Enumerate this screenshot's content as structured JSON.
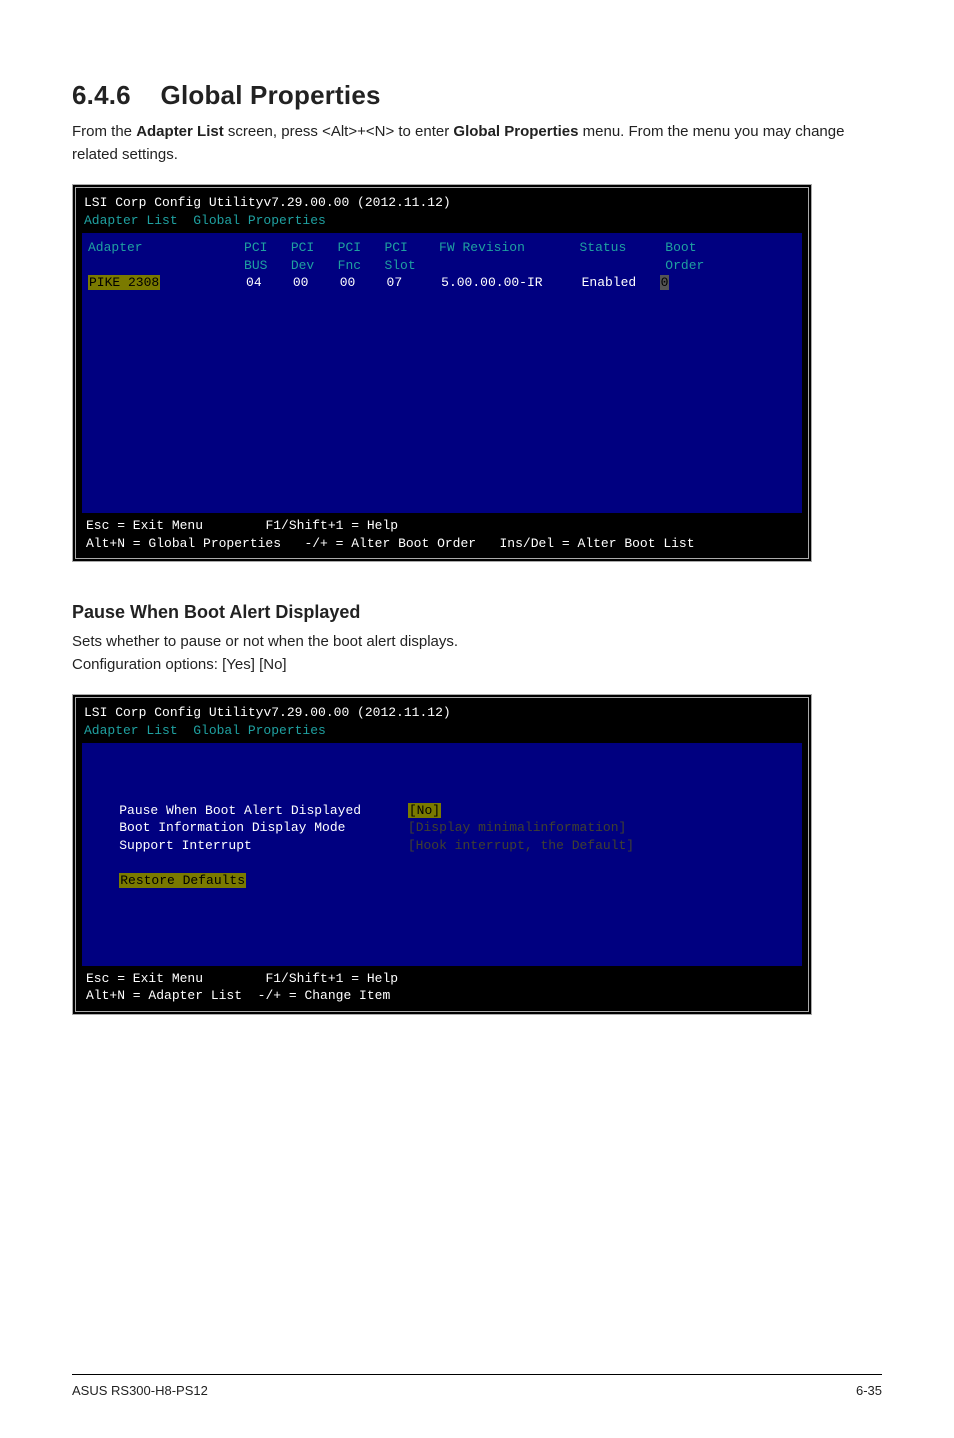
{
  "section": {
    "number": "6.4.6",
    "title": "Global Properties",
    "intro_pre": "From the ",
    "intro_b1": "Adapter List",
    "intro_mid": " screen, press <Alt>+<N> to enter ",
    "intro_b2": "Global Properties",
    "intro_post": " menu. From the menu you may change related settings."
  },
  "bios1": {
    "titlebar_left": "LSI Corp Config Utility",
    "titlebar_ver": "v7.29.00.00 (2012.11.12)",
    "tabs": "Adapter List  Global Properties",
    "headers": {
      "adapter": "Adapter",
      "pci_bus": "PCI\nBUS",
      "pci_dev": "PCI\nDev",
      "pci_fnc": "PCI\nFnc",
      "pci_slot": "PCI\nSlot",
      "fw_rev": "FW Revision",
      "status": "Status",
      "boot_order": "Boot\nOrder"
    },
    "row": {
      "adapter": "PIKE 2308",
      "bus": "04",
      "dev": "00",
      "fnc": "00",
      "slot": "07",
      "fw": "5.00.00.00-IR",
      "status": "Enabled",
      "order": "0"
    },
    "footer_line1_a": "Esc = Exit Menu",
    "footer_line1_b": "F1/Shift+1 = Help",
    "footer_line2_a": "Alt+N = Global Properties",
    "footer_line2_b": "-/+ = Alter Boot Order",
    "footer_line2_c": "Ins/Del = Alter Boot List"
  },
  "sub": {
    "heading": "Pause When Boot Alert Displayed",
    "desc1": "Sets whether to pause or not when the boot alert displays.",
    "desc2": "Configuration options: [Yes] [No]"
  },
  "bios2": {
    "titlebar_left": "LSI Corp Config Utility",
    "titlebar_ver": "v7.29.00.00 (2012.11.12)",
    "tabs": "Adapter List  Global Properties",
    "opts": {
      "pause": "Pause When Boot Alert Displayed",
      "boot_info": "Boot Information Display Mode",
      "support_int": "Support Interrupt",
      "restore": "Restore Defaults"
    },
    "vals": {
      "pause": "[No]",
      "boot_info": "[Display minimalinformation]",
      "support_int": "[Hook interrupt, the Default]"
    },
    "footer_line1_a": "Esc = Exit Menu",
    "footer_line1_b": "F1/Shift+1 = Help",
    "footer_line2_a": "Alt+N = Adapter List",
    "footer_line2_b": "-/+ = Change Item"
  },
  "footer": {
    "left": "ASUS RS300-H8-PS12",
    "right": "6-35"
  }
}
